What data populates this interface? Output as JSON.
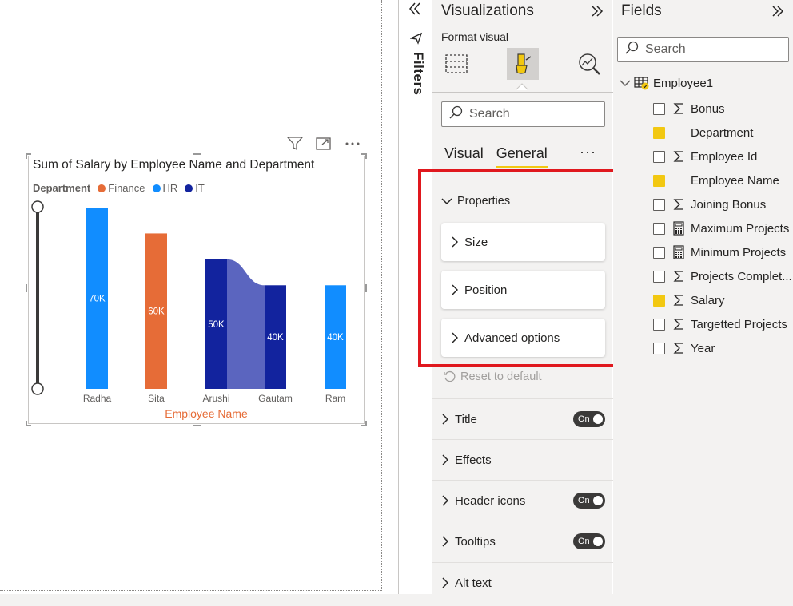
{
  "visual": {
    "title": "Sum of Salary by Employee Name and Department",
    "legend_title": "Department",
    "legend": [
      {
        "name": "Finance",
        "color": "#e66c37"
      },
      {
        "name": "HR",
        "color": "#118dff"
      },
      {
        "name": "IT",
        "color": "#12239e"
      }
    ],
    "xlabel": "Employee Name",
    "xlabel_color": "#e66c37"
  },
  "chart_data": {
    "type": "bar",
    "title": "Sum of Salary by Employee Name and Department",
    "xlabel": "Employee Name",
    "ylabel": "",
    "categories": [
      "Radha",
      "Sita",
      "Arushi",
      "Gautam",
      "Ram"
    ],
    "series": [
      {
        "name": "Finance",
        "color": "#e66c37",
        "values": [
          null,
          60000,
          null,
          null,
          null
        ]
      },
      {
        "name": "HR",
        "color": "#118dff",
        "values": [
          70000,
          null,
          null,
          null,
          40000
        ]
      },
      {
        "name": "IT",
        "color": "#12239e",
        "values": [
          null,
          null,
          50000,
          40000,
          null
        ]
      }
    ],
    "data_labels": [
      "70K",
      "60K",
      "50K",
      "40K",
      "40K"
    ],
    "ylim": [
      0,
      70000
    ],
    "legend_position": "top-left",
    "grid": false
  },
  "filters": {
    "label": "Filters"
  },
  "visualizations": {
    "title": "Visualizations",
    "format_label": "Format visual",
    "search_placeholder": "Search",
    "tabs": [
      "Visual",
      "General"
    ],
    "active_tab": "General",
    "more": "···",
    "properties_header": "Properties",
    "cards": [
      "Size",
      "Position",
      "Advanced options"
    ],
    "reset": "Reset to default",
    "sections": [
      {
        "label": "Title",
        "toggle": "On"
      },
      {
        "label": "Effects",
        "toggle": null
      },
      {
        "label": "Header icons",
        "toggle": "On"
      },
      {
        "label": "Tooltips",
        "toggle": "On"
      },
      {
        "label": "Alt text",
        "toggle": null
      }
    ],
    "icons": [
      "build-visual-icon",
      "format-visual-icon",
      "analytics-icon"
    ]
  },
  "fields": {
    "title": "Fields",
    "search_placeholder": "Search",
    "table": "Employee1",
    "items": [
      {
        "name": "Bonus",
        "type": "sigma",
        "checked": false
      },
      {
        "name": "Department",
        "type": "text",
        "checked": true
      },
      {
        "name": "Employee Id",
        "type": "sigma",
        "checked": false
      },
      {
        "name": "Employee Name",
        "type": "text",
        "checked": true
      },
      {
        "name": "Joining Bonus",
        "type": "sigma",
        "checked": false
      },
      {
        "name": "Maximum Projects",
        "type": "calc",
        "checked": false
      },
      {
        "name": "Minimum Projects",
        "type": "calc",
        "checked": false
      },
      {
        "name": "Projects Complet...",
        "type": "sigma",
        "checked": false
      },
      {
        "name": "Salary",
        "type": "sigma",
        "checked": true
      },
      {
        "name": "Targetted Projects",
        "type": "sigma",
        "checked": false
      },
      {
        "name": "Year",
        "type": "sigma",
        "checked": false
      }
    ]
  }
}
